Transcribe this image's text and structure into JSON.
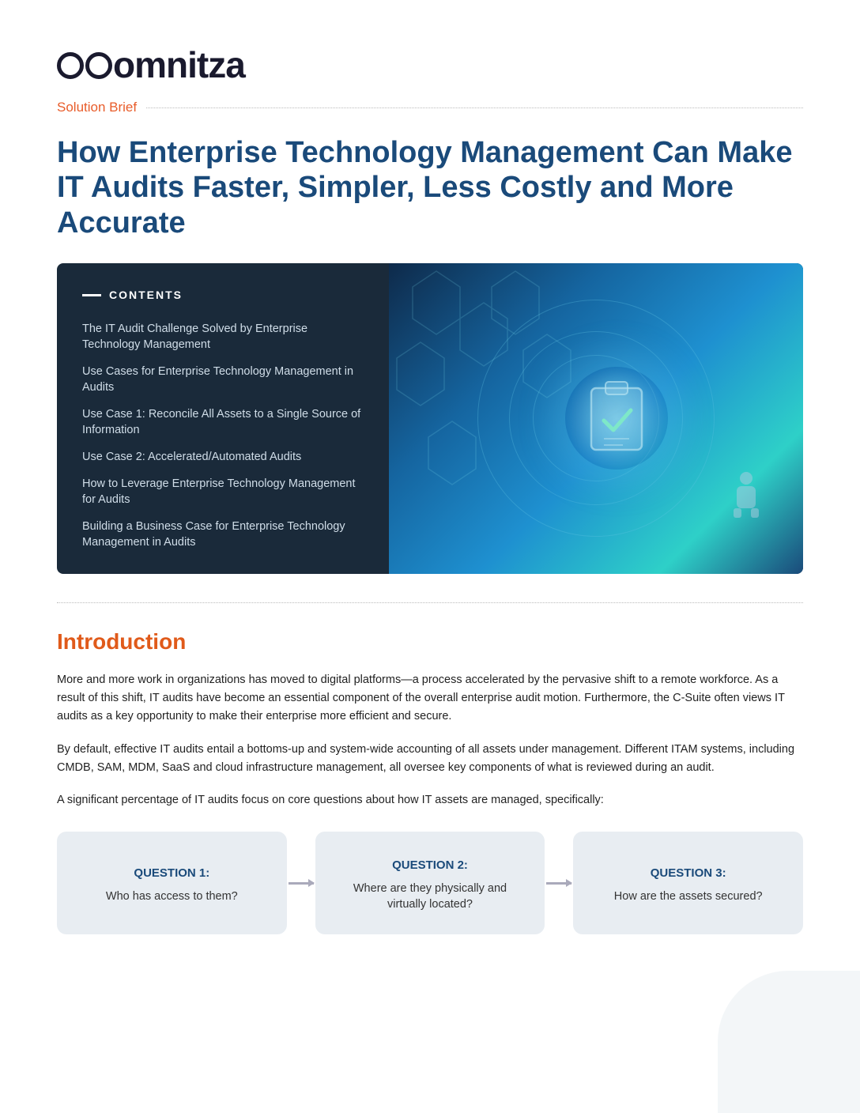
{
  "logo": {
    "text": "omnitza",
    "aria": "Omnitza logo"
  },
  "solution_brief": {
    "label": "Solution Brief"
  },
  "main_title": "How Enterprise Technology Management Can Make IT Audits Faster, Simpler, Less Costly and More Accurate",
  "contents": {
    "header": "CONTENTS",
    "items": [
      "The IT Audit Challenge Solved by Enterprise Technology Management",
      "Use Cases for Enterprise Technology Management in Audits",
      "Use Case 1: Reconcile All Assets to a Single Source of Information",
      "Use Case 2: Accelerated/Automated Audits",
      "How to Leverage Enterprise Technology Management for Audits",
      "Building a Business Case for Enterprise Technology Management in Audits"
    ]
  },
  "introduction": {
    "title": "Introduction",
    "paragraphs": [
      "More and more work in organizations has moved to digital platforms—a process accelerated by the pervasive shift to a remote workforce. As a result of this shift, IT audits have become an essential component of the overall enterprise audit motion. Furthermore, the C-Suite often views IT audits as a key opportunity to make their enterprise more efficient and secure.",
      "By default, effective IT audits entail a bottoms-up and system-wide accounting of all assets under management. Different ITAM systems, including CMDB, SAM, MDM, SaaS and cloud infrastructure management, all oversee key components of what is reviewed during an audit.",
      "A significant percentage of IT audits focus on core questions about how IT assets are managed, specifically:"
    ]
  },
  "questions": [
    {
      "label": "QUESTION 1:",
      "text": "Who has access to them?"
    },
    {
      "label": "QUESTION 2:",
      "text": "Where are they physically and virtually located?"
    },
    {
      "label": "QUESTION 3:",
      "text": "How are the assets secured?"
    }
  ]
}
